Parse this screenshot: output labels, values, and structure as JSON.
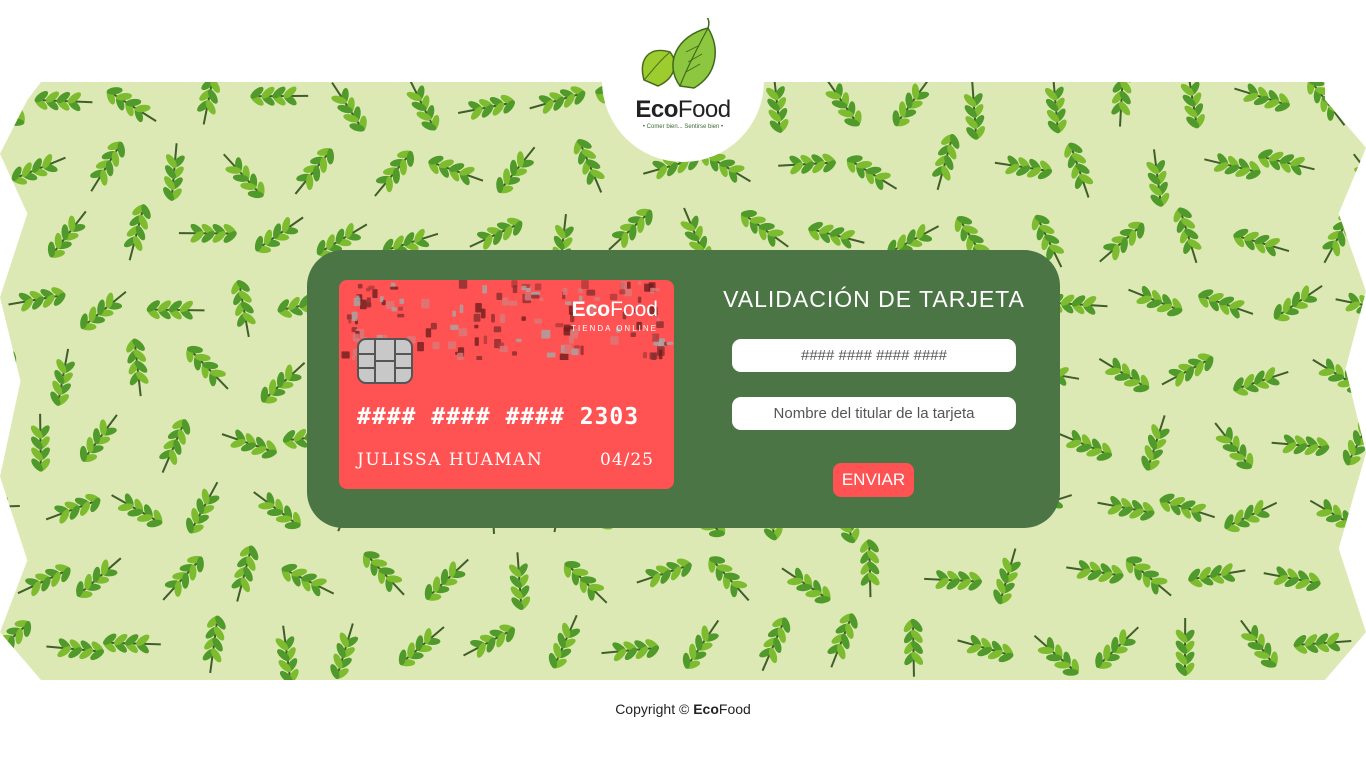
{
  "header": {
    "logo_eco": "Eco",
    "logo_food": "Food",
    "logo_tagline": "• Comer bien... Sentirse bien •",
    "logo_icon": "double-leaf-icon"
  },
  "card": {
    "brand_eco": "Eco",
    "brand_food": "Food",
    "brand_sub": "TIENDA ONLINE",
    "number": "#### #### #### 2303",
    "holder": "JULISSA HUAMAN",
    "expiry": "04/25",
    "chip_icon": "sim-chip-icon",
    "color": "#ff5252"
  },
  "form": {
    "title": "VALIDACIÓN DE TARJETA",
    "number_placeholder": "#### #### #### ####",
    "name_placeholder": "Nombre del titular de la tarjeta",
    "submit_label": "ENVIAR",
    "panel_color": "#4b7545"
  },
  "footer": {
    "prefix": "Copyright ©",
    "brand_eco": "Eco",
    "brand_food": "Food"
  },
  "background": {
    "pattern": "leaf-branch-pattern",
    "color": "#dde9b4"
  }
}
